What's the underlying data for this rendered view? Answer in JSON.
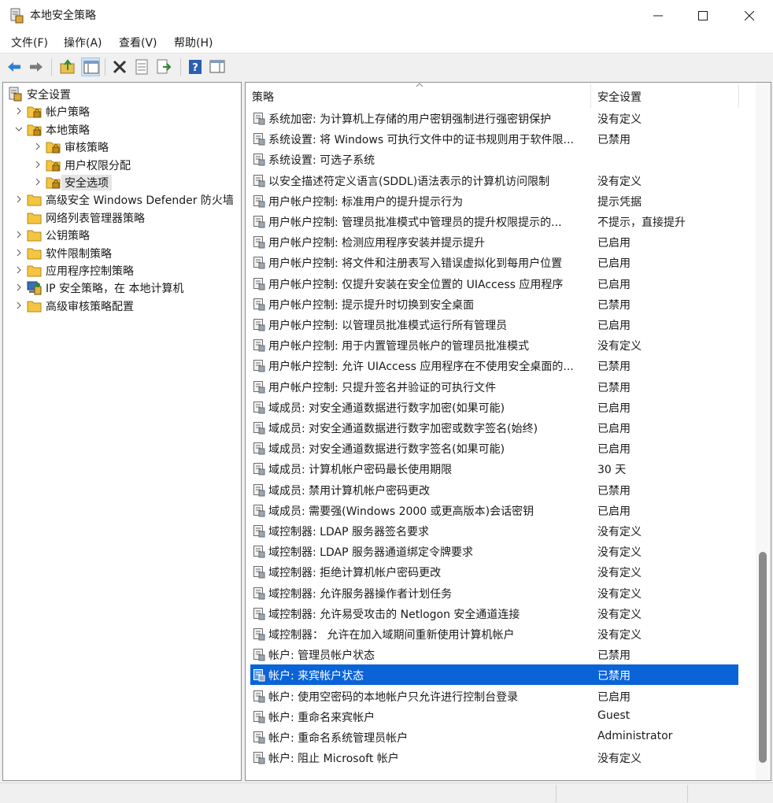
{
  "window": {
    "title": "本地安全策略"
  },
  "menu": [
    "文件(F)",
    "操作(A)",
    "查看(V)",
    "帮助(H)"
  ],
  "tree": [
    {
      "label": "安全设置",
      "level": 0,
      "expanded": true,
      "icon": "security-settings-icon"
    },
    {
      "label": "帐户策略",
      "level": 1,
      "expanded": false,
      "icon": "folder-lock-icon"
    },
    {
      "label": "本地策略",
      "level": 1,
      "expanded": true,
      "icon": "folder-lock-icon"
    },
    {
      "label": "审核策略",
      "level": 2,
      "expanded": false,
      "icon": "folder-lock-icon"
    },
    {
      "label": "用户权限分配",
      "level": 2,
      "expanded": false,
      "icon": "folder-lock-icon"
    },
    {
      "label": "安全选项",
      "level": 2,
      "expanded": false,
      "icon": "folder-lock-icon",
      "selected": true
    },
    {
      "label": "高级安全 Windows Defender 防火墙",
      "level": 1,
      "expanded": false,
      "icon": "folder-icon"
    },
    {
      "label": "网络列表管理器策略",
      "level": 1,
      "expanded": null,
      "icon": "folder-icon"
    },
    {
      "label": "公钥策略",
      "level": 1,
      "expanded": false,
      "icon": "folder-icon"
    },
    {
      "label": "软件限制策略",
      "level": 1,
      "expanded": false,
      "icon": "folder-icon"
    },
    {
      "label": "应用程序控制策略",
      "level": 1,
      "expanded": false,
      "icon": "folder-icon"
    },
    {
      "label": "IP 安全策略，在 本地计算机",
      "level": 1,
      "expanded": false,
      "icon": "ip-security-icon"
    },
    {
      "label": "高级审核策略配置",
      "level": 1,
      "expanded": false,
      "icon": "folder-icon"
    }
  ],
  "columns": {
    "policy": "策略",
    "setting": "安全设置"
  },
  "rows": [
    {
      "name": "系统加密: 为计算机上存储的用户密钥强制进行强密钥保护",
      "value": "没有定义"
    },
    {
      "name": "系统设置: 将 Windows 可执行文件中的证书规则用于软件限...",
      "value": "已禁用"
    },
    {
      "name": "系统设置: 可选子系统",
      "value": ""
    },
    {
      "name": "以安全描述符定义语言(SDDL)语法表示的计算机访问限制",
      "value": "没有定义"
    },
    {
      "name": "用户帐户控制: 标准用户的提升提示行为",
      "value": "提示凭据"
    },
    {
      "name": "用户帐户控制: 管理员批准模式中管理员的提升权限提示的...",
      "value": "不提示，直接提升"
    },
    {
      "name": "用户帐户控制: 检测应用程序安装并提示提升",
      "value": "已启用"
    },
    {
      "name": "用户帐户控制: 将文件和注册表写入错误虚拟化到每用户位置",
      "value": "已启用"
    },
    {
      "name": "用户帐户控制: 仅提升安装在安全位置的 UIAccess 应用程序",
      "value": "已启用"
    },
    {
      "name": "用户帐户控制: 提示提升时切换到安全桌面",
      "value": "已禁用"
    },
    {
      "name": "用户帐户控制: 以管理员批准模式运行所有管理员",
      "value": "已启用"
    },
    {
      "name": "用户帐户控制: 用于内置管理员帐户的管理员批准模式",
      "value": "没有定义"
    },
    {
      "name": "用户帐户控制: 允许 UIAccess 应用程序在不使用安全桌面的...",
      "value": "已禁用"
    },
    {
      "name": "用户帐户控制: 只提升签名并验证的可执行文件",
      "value": "已禁用"
    },
    {
      "name": "域成员: 对安全通道数据进行数字加密(如果可能)",
      "value": "已启用"
    },
    {
      "name": "域成员: 对安全通道数据进行数字加密或数字签名(始终)",
      "value": "已启用"
    },
    {
      "name": "域成员: 对安全通道数据进行数字签名(如果可能)",
      "value": "已启用"
    },
    {
      "name": "域成员: 计算机帐户密码最长使用期限",
      "value": "30 天"
    },
    {
      "name": "域成员: 禁用计算机帐户密码更改",
      "value": "已禁用"
    },
    {
      "name": "域成员: 需要强(Windows 2000 或更高版本)会话密钥",
      "value": "已启用"
    },
    {
      "name": "域控制器: LDAP 服务器签名要求",
      "value": "没有定义"
    },
    {
      "name": "域控制器: LDAP 服务器通道绑定令牌要求",
      "value": "没有定义"
    },
    {
      "name": "域控制器: 拒绝计算机帐户密码更改",
      "value": "没有定义"
    },
    {
      "name": "域控制器: 允许服务器操作者计划任务",
      "value": "没有定义"
    },
    {
      "name": "域控制器: 允许易受攻击的 Netlogon 安全通道连接",
      "value": "没有定义"
    },
    {
      "name": "域控制器：  允许在加入域期间重新使用计算机帐户",
      "value": "没有定义"
    },
    {
      "name": "帐户: 管理员帐户状态",
      "value": "已禁用"
    },
    {
      "name": "帐户: 来宾帐户状态",
      "value": "已禁用",
      "selected": true
    },
    {
      "name": "帐户: 使用空密码的本地帐户只允许进行控制台登录",
      "value": "已启用"
    },
    {
      "name": "帐户: 重命名来宾帐户",
      "value": "Guest"
    },
    {
      "name": "帐户: 重命名系统管理员帐户",
      "value": "Administrator"
    },
    {
      "name": "帐户: 阻止 Microsoft 帐户",
      "value": "没有定义"
    }
  ],
  "colors": {
    "selection": "#0a64d8",
    "folder": "#f4c542"
  }
}
